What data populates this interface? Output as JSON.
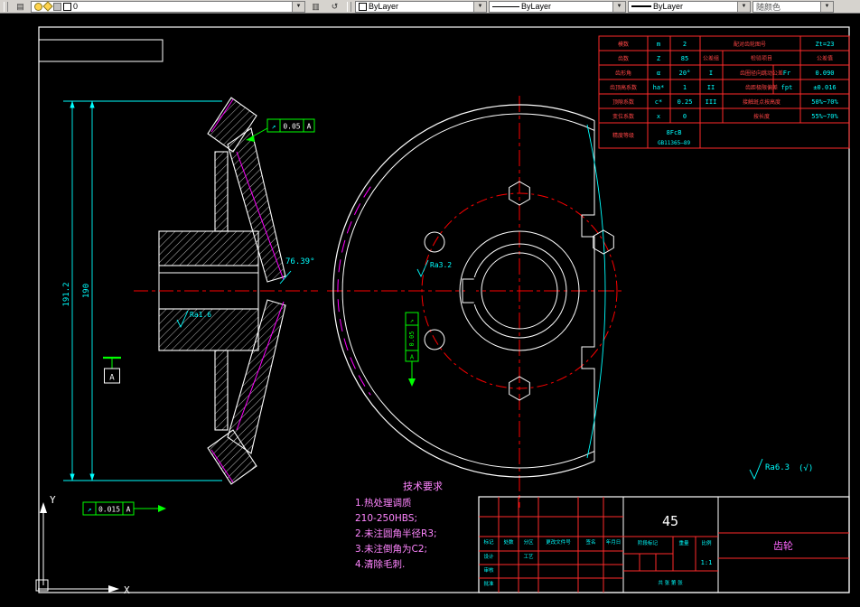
{
  "toolbar": {
    "layer": {
      "value": "0"
    },
    "color": {
      "value": "ByLayer"
    },
    "linetype": {
      "value": "ByLayer"
    },
    "lineweight": {
      "value": "ByLayer"
    },
    "plotstyle": {
      "value": "随颜色"
    }
  },
  "icons": {
    "dropdown": "▼",
    "layers": "▤",
    "set_layer": "▥",
    "layer_previous": "↺"
  },
  "drawing": {
    "dims": {
      "outer_height": "191.2",
      "inner_height": "190",
      "cone_angle": "76.39°"
    },
    "tolerances": {
      "runout_symbol": "↗",
      "top": {
        "value": "0.05",
        "datum": "A"
      },
      "bottom": {
        "value": "0.015",
        "datum": "A"
      },
      "side": {
        "value": "0.05",
        "datum": "A"
      },
      "datum_label": "A"
    },
    "roughness": {
      "hub": "Ra1.6",
      "hole": "Ra3.2",
      "general": "Ra6.3",
      "general_suffix": "(√)"
    },
    "tech_req": {
      "title": "技术要求",
      "line1": "1.热处理调质",
      "line2": "210-250HBS;",
      "line3": "2.未注圆角半径R3;",
      "line4": "3.未注倒角为C2;",
      "line5": "4.清除毛刺."
    },
    "ucs": {
      "x_label": "X",
      "y_label": "Y"
    }
  },
  "gear_table": {
    "rows": [
      {
        "label": "模数",
        "sym": "m",
        "val": "2"
      },
      {
        "label": "齿数",
        "sym": "Z",
        "val": "85"
      },
      {
        "label": "齿形角",
        "sym": "α",
        "val": "20°"
      },
      {
        "label": "齿顶高系数",
        "sym": "ha*",
        "val": "1"
      },
      {
        "label": "顶隙系数",
        "sym": "c*",
        "val": "0.25"
      },
      {
        "label": "变位系数",
        "sym": "x",
        "val": "0"
      }
    ],
    "precision": {
      "label": "精度等级",
      "value": "8FcB",
      "standard": "GB11365—89"
    },
    "mate": {
      "label": "配对齿轮图号",
      "teeth": "Zt=23"
    },
    "header": {
      "group": "公差组",
      "item": "检验项目",
      "tol": "公差值"
    },
    "checks": [
      {
        "group": "I",
        "item": "齿圈径向跳动公差",
        "code": "Fr",
        "value": "0.090"
      },
      {
        "group": "II",
        "item": "齿距极限偏差",
        "code": "fpt",
        "value": "±0.016"
      },
      {
        "group": "III",
        "item": "接触斑点按高度",
        "code": "",
        "value": "50%~70%"
      },
      {
        "group": "",
        "item": "按长度",
        "code": "",
        "value": "55%~70%"
      }
    ]
  },
  "title_block": {
    "material": "45",
    "scale": "1:1",
    "part_name": "齿轮",
    "labels": {
      "mark": "标记",
      "count": "处数",
      "zone": "分区",
      "change_doc": "更改文件号",
      "sign": "签名",
      "date": "年月日",
      "design": "设计",
      "check": "审核",
      "process": "工艺",
      "approve": "批准",
      "stage": "阶段标记",
      "weight": "重量",
      "scale_label": "比例",
      "sheets": "共 张 第 张"
    }
  }
}
